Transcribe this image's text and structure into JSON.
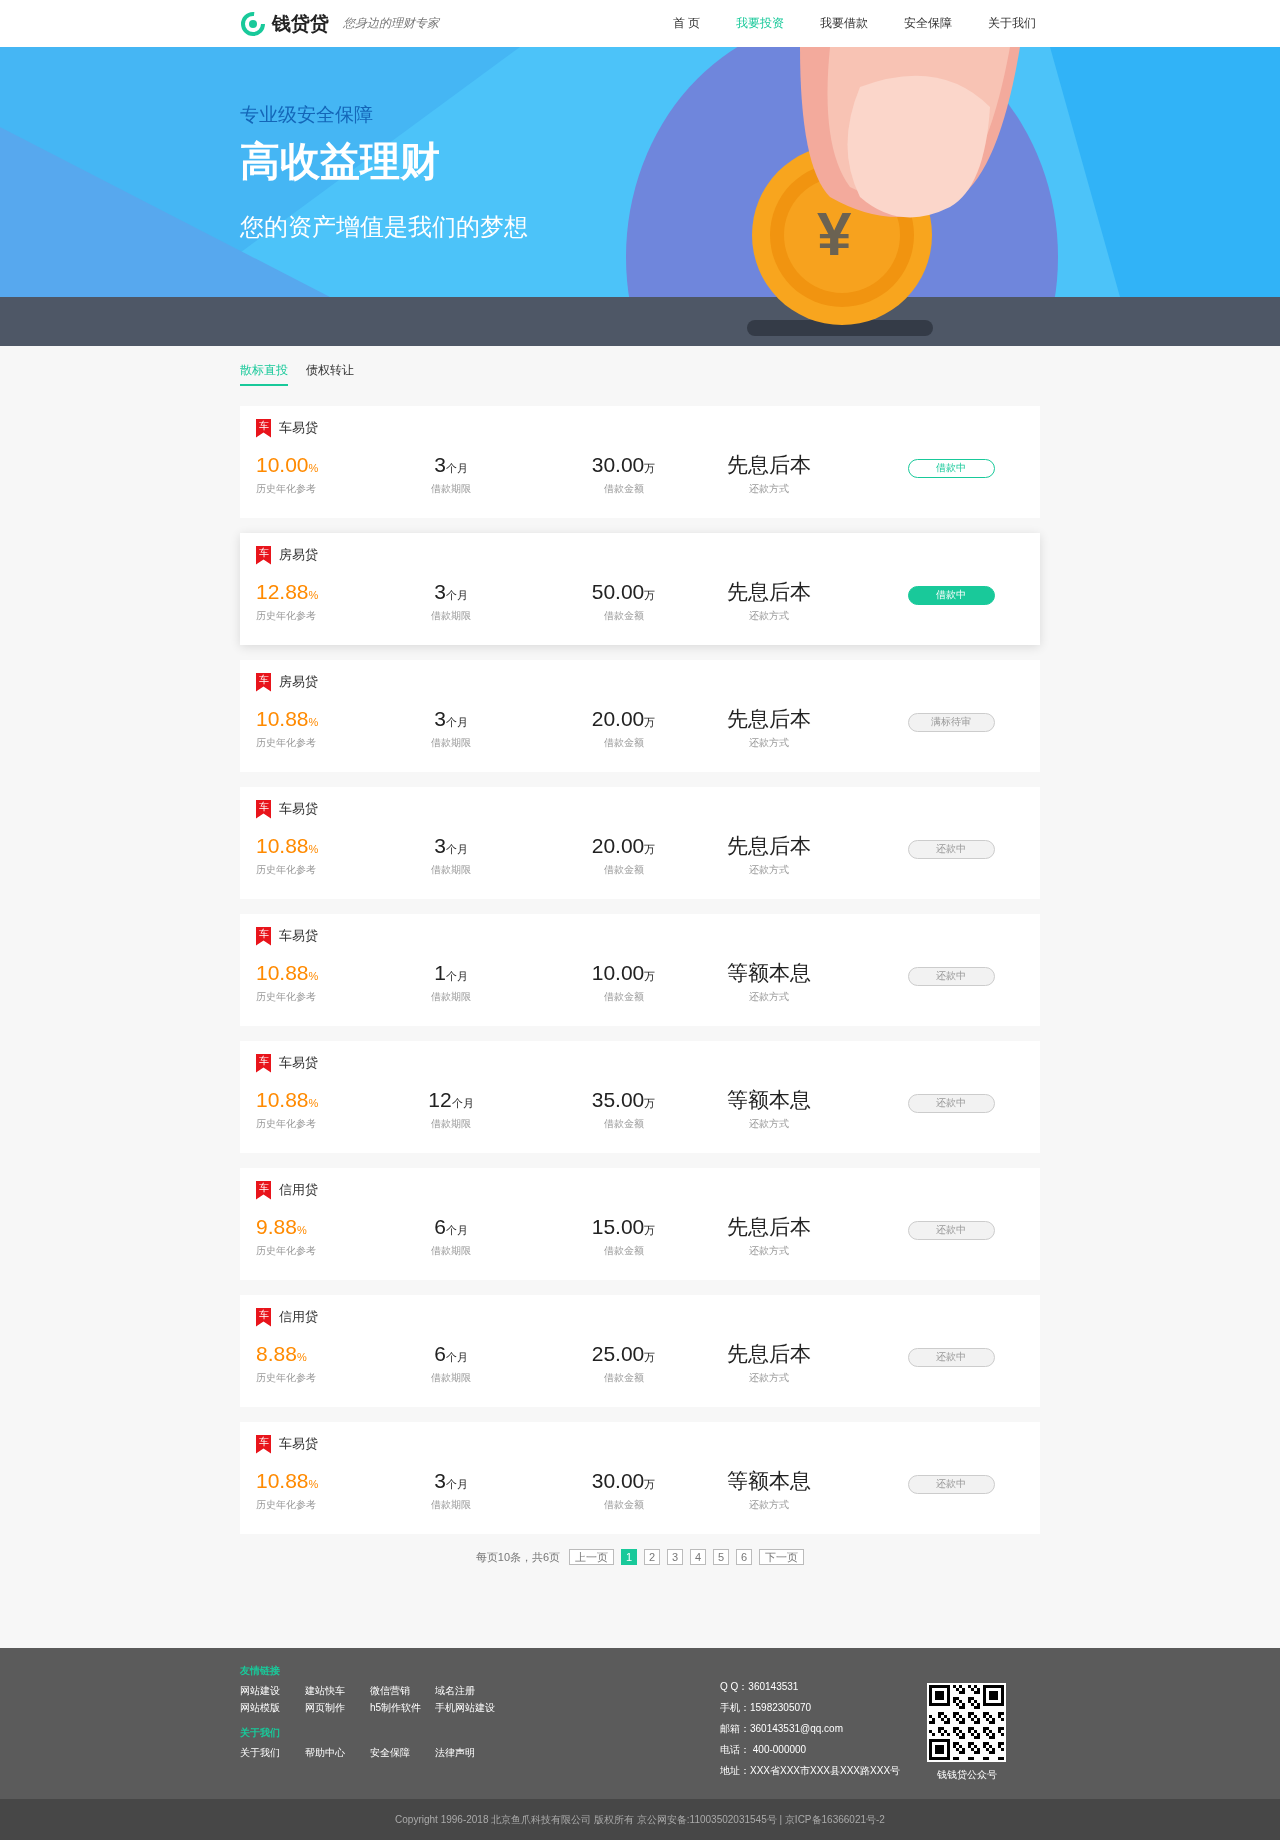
{
  "header": {
    "logo": {
      "name": "钱贷贷",
      "slogan": "您身边的理财专家"
    },
    "nav": [
      {
        "label": "首 页",
        "selected": false
      },
      {
        "label": "我要投资",
        "selected": true
      },
      {
        "label": "我要借款",
        "selected": false
      },
      {
        "label": "安全保障",
        "selected": false
      },
      {
        "label": "关于我们",
        "selected": false
      }
    ]
  },
  "hero": {
    "kicker": "专业级安全保障",
    "title": "高收益理财",
    "subtitle": "您的资产增值是我们的梦想",
    "coin_symbol": "¥"
  },
  "tabs": [
    {
      "label": "散标直投",
      "selected": true
    },
    {
      "label": "债权转让",
      "selected": false
    }
  ],
  "loans": [
    {
      "tag": "车",
      "name": "车易贷",
      "rate": "10.00",
      "rate_unit": "%",
      "rate_label": "历史年化参考",
      "term": "3",
      "term_unit": "个月",
      "term_label": "借款期限",
      "amount": "30.00",
      "amount_unit": "万",
      "amount_label": "借款金额",
      "method": "先息后本",
      "method_label": "还款方式",
      "status": {
        "label": "借款中",
        "kind": "open"
      },
      "selected": false
    },
    {
      "tag": "车",
      "name": "房易贷",
      "rate": "12.88",
      "rate_unit": "%",
      "rate_label": "历史年化参考",
      "term": "3",
      "term_unit": "个月",
      "term_label": "借款期限",
      "amount": "50.00",
      "amount_unit": "万",
      "amount_label": "借款金额",
      "method": "先息后本",
      "method_label": "还款方式",
      "status": {
        "label": "借款中",
        "kind": "open"
      },
      "selected": true
    },
    {
      "tag": "车",
      "name": "房易贷",
      "rate": "10.88",
      "rate_unit": "%",
      "rate_label": "历史年化参考",
      "term": "3",
      "term_unit": "个月",
      "term_label": "借款期限",
      "amount": "20.00",
      "amount_unit": "万",
      "amount_label": "借款金额",
      "method": "先息后本",
      "method_label": "还款方式",
      "status": {
        "label": "满标待审",
        "kind": "closed"
      },
      "selected": false
    },
    {
      "tag": "车",
      "name": "车易贷",
      "rate": "10.88",
      "rate_unit": "%",
      "rate_label": "历史年化参考",
      "term": "3",
      "term_unit": "个月",
      "term_label": "借款期限",
      "amount": "20.00",
      "amount_unit": "万",
      "amount_label": "借款金额",
      "method": "先息后本",
      "method_label": "还款方式",
      "status": {
        "label": "还款中",
        "kind": "closed"
      },
      "selected": false
    },
    {
      "tag": "车",
      "name": "车易贷",
      "rate": "10.88",
      "rate_unit": "%",
      "rate_label": "历史年化参考",
      "term": "1",
      "term_unit": "个月",
      "term_label": "借款期限",
      "amount": "10.00",
      "amount_unit": "万",
      "amount_label": "借款金额",
      "method": "等额本息",
      "method_label": "还款方式",
      "status": {
        "label": "还款中",
        "kind": "closed"
      },
      "selected": false
    },
    {
      "tag": "车",
      "name": "车易贷",
      "rate": "10.88",
      "rate_unit": "%",
      "rate_label": "历史年化参考",
      "term": "12",
      "term_unit": "个月",
      "term_label": "借款期限",
      "amount": "35.00",
      "amount_unit": "万",
      "amount_label": "借款金额",
      "method": "等额本息",
      "method_label": "还款方式",
      "status": {
        "label": "还款中",
        "kind": "closed"
      },
      "selected": false
    },
    {
      "tag": "车",
      "name": "信用贷",
      "rate": "9.88",
      "rate_unit": "%",
      "rate_label": "历史年化参考",
      "term": "6",
      "term_unit": "个月",
      "term_label": "借款期限",
      "amount": "15.00",
      "amount_unit": "万",
      "amount_label": "借款金额",
      "method": "先息后本",
      "method_label": "还款方式",
      "status": {
        "label": "还款中",
        "kind": "closed"
      },
      "selected": false
    },
    {
      "tag": "车",
      "name": "信用贷",
      "rate": "8.88",
      "rate_unit": "%",
      "rate_label": "历史年化参考",
      "term": "6",
      "term_unit": "个月",
      "term_label": "借款期限",
      "amount": "25.00",
      "amount_unit": "万",
      "amount_label": "借款金额",
      "method": "先息后本",
      "method_label": "还款方式",
      "status": {
        "label": "还款中",
        "kind": "closed"
      },
      "selected": false
    },
    {
      "tag": "车",
      "name": "车易贷",
      "rate": "10.88",
      "rate_unit": "%",
      "rate_label": "历史年化参考",
      "term": "3",
      "term_unit": "个月",
      "term_label": "借款期限",
      "amount": "30.00",
      "amount_unit": "万",
      "amount_label": "借款金额",
      "method": "等额本息",
      "method_label": "还款方式",
      "status": {
        "label": "还款中",
        "kind": "closed"
      },
      "selected": false
    }
  ],
  "pagination": {
    "summary": "每页10条，共6页",
    "prev": "上一页",
    "pages": [
      {
        "label": "1",
        "selected": true
      },
      {
        "label": "2",
        "selected": false
      },
      {
        "label": "3",
        "selected": false
      },
      {
        "label": "4",
        "selected": false
      },
      {
        "label": "5",
        "selected": false
      },
      {
        "label": "6",
        "selected": false
      }
    ],
    "next": "下一页"
  },
  "footer": {
    "links_heading": "友情链接",
    "links": [
      "网站建设",
      "建站快车",
      "微信营销",
      "域名注册",
      "网站模版",
      "网页制作",
      "h5制作软件",
      "手机网站建设"
    ],
    "about_heading": "关于我们",
    "about_links": [
      "关于我们",
      "帮助中心",
      "安全保障",
      "法律声明"
    ],
    "contacts": [
      "Q Q：360143531",
      "手机：15982305070",
      "邮箱：360143531@qq.com",
      "电话： 400-000000",
      "地址：XXX省XXX市XXX县XXX路XXX号"
    ],
    "qr_caption": "钱钱贷公众号",
    "copyright": "Copyright 1996-2018 北京鱼爪科技有限公司 版权所有 京公网安备:11003502031545号 | 京ICP备16366021号-2"
  }
}
